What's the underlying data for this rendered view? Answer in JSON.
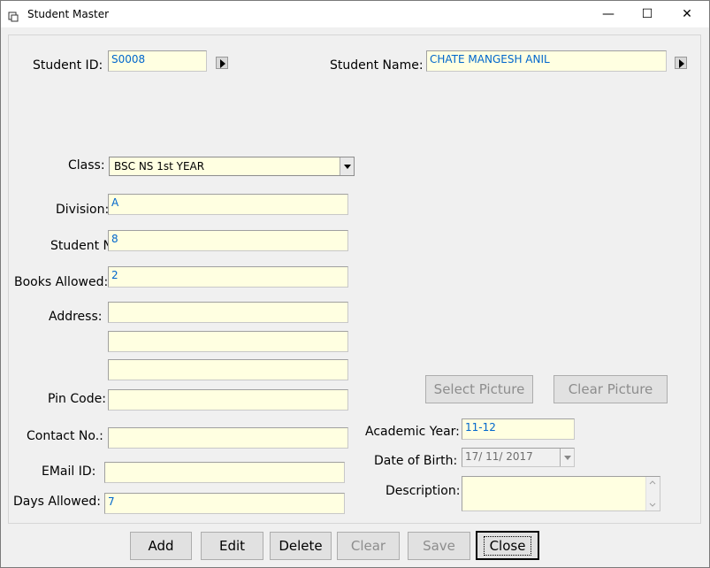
{
  "window": {
    "title": "Student Master",
    "minimize": "—",
    "maximize": "☐",
    "close": "✕"
  },
  "form": {
    "student_id_label": "Student ID:",
    "student_id_value": "S0008",
    "student_name_label": "Student Name:",
    "student_name_value": "CHATE MANGESH ANIL",
    "class_label": "Class:",
    "class_value": "BSC NS  1st YEAR",
    "division_label": "Division:",
    "division_value": "A",
    "student_no_label": "Student No.:",
    "student_no_value": "8",
    "books_allowed_label": "Books Allowed:",
    "books_allowed_value": "2",
    "address_label": "Address:",
    "address_line1": "",
    "address_line2": "",
    "address_line3": "",
    "pin_code_label": "Pin Code:",
    "pin_code_value": "",
    "contact_no_label": "Contact No.:",
    "contact_no_value": "",
    "email_label": "EMail ID:",
    "email_value": "",
    "days_allowed_label": "Days Allowed:",
    "days_allowed_value": "7",
    "academic_year_label": "Academic Year:",
    "academic_year_value": "11-12",
    "dob_label": "Date of Birth:",
    "dob_value": "17/ 11/ 2017",
    "description_label": "Description:",
    "description_value": "",
    "select_picture": "Select Picture",
    "clear_picture": "Clear Picture"
  },
  "buttons": {
    "add": "Add",
    "edit": "Edit",
    "delete": "Delete",
    "clear": "Clear",
    "save": "Save",
    "close": "Close"
  },
  "colors": {
    "field_bg": "#ffffe1",
    "value_text": "#0066cc"
  }
}
